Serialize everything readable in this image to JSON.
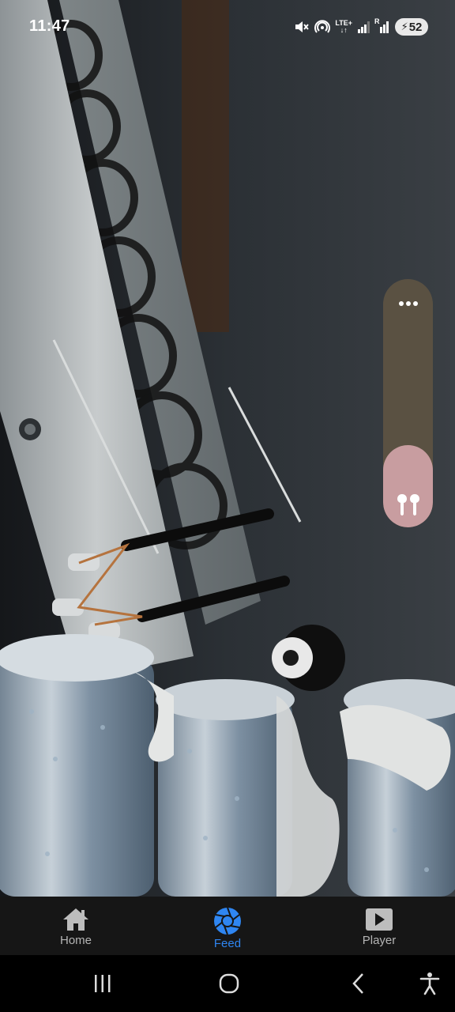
{
  "status_bar": {
    "time": "11:47",
    "icons": [
      "mute-icon",
      "hotspot-icon",
      "lte-icon",
      "signal-icon",
      "signal-r-icon"
    ],
    "lte_label": "LTE+",
    "roaming_label": "R",
    "battery_level": "52",
    "battery_charging": true
  },
  "volume_panel": {
    "level_fraction": 0.33,
    "output_device": "earbuds",
    "more_icon": "more-dots-icon",
    "colors": {
      "track": "#5a5142",
      "fill": "#c89da0"
    }
  },
  "bottom_nav": {
    "items": [
      {
        "label": "Home",
        "icon": "home-icon",
        "active": false
      },
      {
        "label": "Feed",
        "icon": "camera-shutter-icon",
        "active": true
      },
      {
        "label": "Player",
        "icon": "play-icon",
        "active": false
      }
    ],
    "active_color": "#2f86f2"
  },
  "system_nav": {
    "buttons": [
      "recent-apps-icon",
      "home-circle-icon",
      "back-icon",
      "accessibility-icon"
    ]
  }
}
